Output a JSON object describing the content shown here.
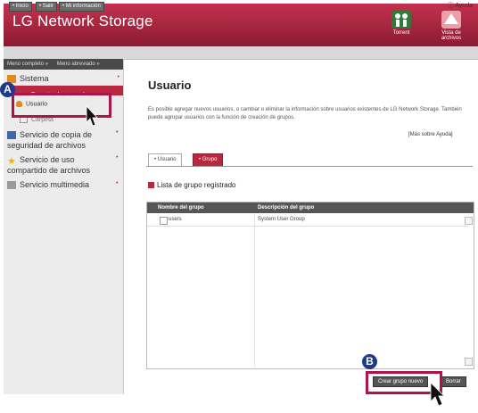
{
  "header": {
    "title": "LG Network Storage",
    "btn_torrent": "Torrent",
    "btn_file_view": "Vista de archivos"
  },
  "toolbar": {
    "home": "• Inicio",
    "exit": "• Salir",
    "info": "• Mi información",
    "help": "Ayuda"
  },
  "sidebar": {
    "menu_full": "Menú completo »",
    "menu_short": "Menú abreviado »",
    "items": [
      {
        "label": "Sistema"
      },
      {
        "label": "Cuenta de usuario"
      },
      {
        "label": "Usuario"
      },
      {
        "label": "Carpeta"
      },
      {
        "label": "Servicio de copia de seguridad de archivos"
      },
      {
        "label": "Servicio de uso compartido de archivos"
      },
      {
        "label": "Servicio multimedia"
      }
    ]
  },
  "main": {
    "title": "Usuario",
    "description": "Es posible agregar nuevos usuarios, o cambiar o eliminar la información sobre usuarios existentes de LG Network Storage. También puede agrupar usuarios con la función de creación de grupos.",
    "help_link": "[Más sobre Ayuda]",
    "tabs": [
      {
        "label": "• Usuario"
      },
      {
        "label": "• Grupo"
      }
    ],
    "group_list_heading": "Lista de grupo registrado",
    "table": {
      "columns": [
        "Nombre del grupo",
        "Descripción del grupo"
      ],
      "rows": [
        {
          "name": "users",
          "description": "System User Group"
        }
      ]
    },
    "btn_create": "Crear grupo nuevo",
    "btn_delete": "Borrar"
  },
  "annotations": {
    "a": "A",
    "b": "B"
  },
  "colors": {
    "header": "#a5223f",
    "accent": "#b0134a",
    "badge": "#1e3a8a"
  }
}
